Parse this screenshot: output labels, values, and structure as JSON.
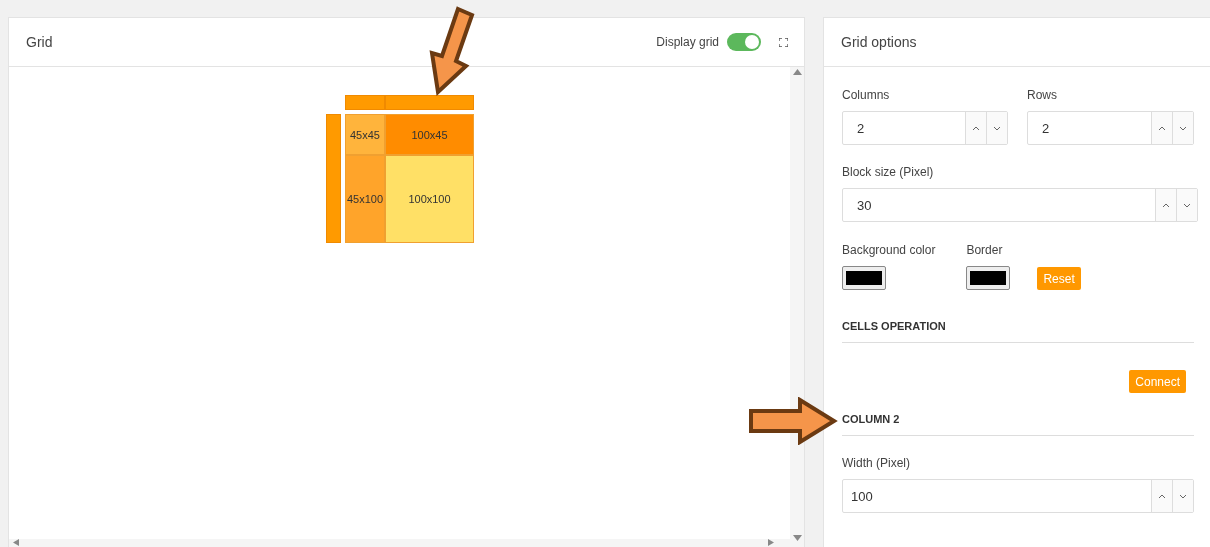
{
  "grid_panel": {
    "title": "Grid",
    "display_grid": {
      "label": "Display grid",
      "on": true
    },
    "cells": [
      {
        "label": "45x45",
        "color": "#ffb43c"
      },
      {
        "label": "100x45",
        "color": "#ff8c00"
      },
      {
        "label": "45x100",
        "color": "#ffa42a"
      },
      {
        "label": "100x100",
        "color": "#ffe066"
      }
    ]
  },
  "options_panel": {
    "title": "Grid options",
    "columns": {
      "label": "Columns",
      "value": "2"
    },
    "rows": {
      "label": "Rows",
      "value": "2"
    },
    "block_size": {
      "label": "Block size (Pixel)",
      "value": "30"
    },
    "background_color": {
      "label": "Background color",
      "color": "#000000"
    },
    "border": {
      "label": "Border",
      "color": "#000000"
    },
    "reset_button": "Reset",
    "cells_operation": {
      "heading": "CELLS OPERATION",
      "button": "Connect"
    },
    "column_section": {
      "heading": "COLUMN 2",
      "width": {
        "label": "Width (Pixel)",
        "value": "100"
      }
    }
  }
}
